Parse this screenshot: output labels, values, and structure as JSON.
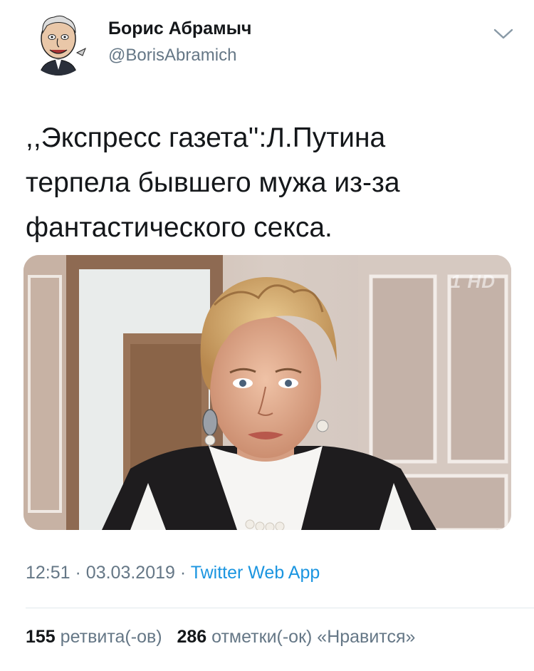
{
  "author": {
    "display_name": "Борис Абрамыч",
    "handle": "@BorisAbramich"
  },
  "tweet": {
    "text": ",,Экспресс газета'':Л.Путина\nтерпела бывшего мужа из-за\nфантастического секса."
  },
  "media": {
    "channel_logo": "1 HD"
  },
  "meta": {
    "time": "12:51",
    "date": "03.03.2019",
    "separator": "·",
    "source": "Twitter Web App"
  },
  "stats": {
    "retweets_count": "155",
    "retweets_label": "ретвита(-ов)",
    "likes_count": "286",
    "likes_label": "отметки(-ок) «Нравится»"
  },
  "colors": {
    "text_primary": "#14171a",
    "text_secondary": "#657786",
    "link": "#1b95e0",
    "divider": "#e1e8ed"
  },
  "icons": {
    "caret": "chevron-down-icon"
  }
}
